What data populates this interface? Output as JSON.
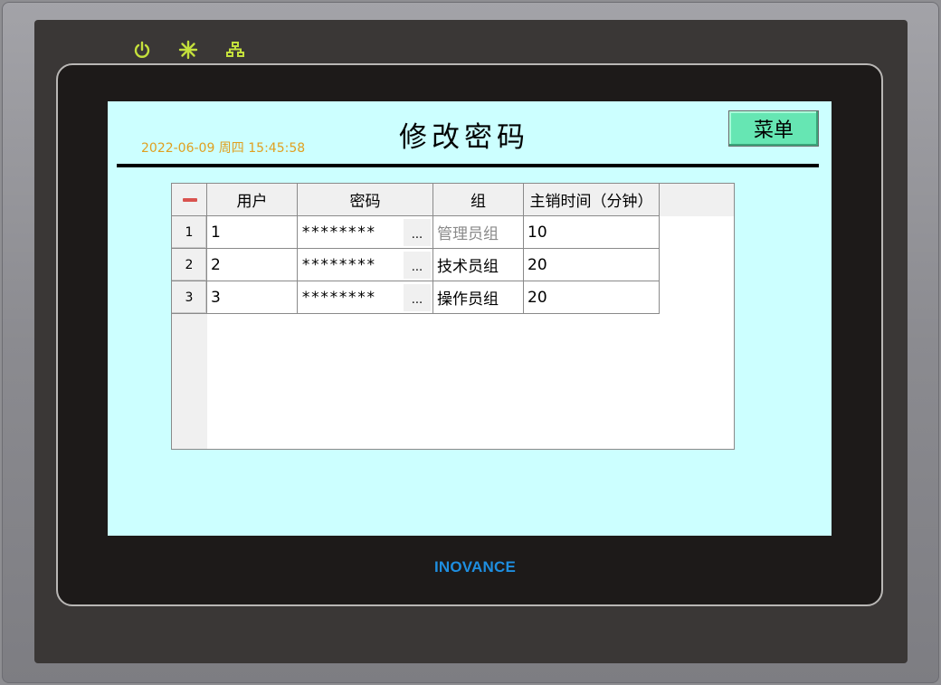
{
  "device": {
    "brand": "INOVANCE",
    "indicators": [
      "power-icon",
      "run-icon",
      "network-icon"
    ],
    "indicator_color": "#c4e03c"
  },
  "screen": {
    "background": "#ccffff",
    "datetime": "2022-06-09 周四 15:45:58",
    "title": "修改密码",
    "menu_label": "菜单"
  },
  "table": {
    "columns": [
      "用户",
      "密码",
      "组",
      "主销时间（分钟）"
    ],
    "rows": [
      {
        "index": "1",
        "user": "1",
        "password": "********",
        "group": "管理员组",
        "timeout": "10"
      },
      {
        "index": "2",
        "user": "2",
        "password": "********",
        "group": "技术员组",
        "timeout": "20"
      },
      {
        "index": "3",
        "user": "3",
        "password": "********",
        "group": "操作员组",
        "timeout": "20"
      }
    ],
    "ellipsis": "..."
  }
}
